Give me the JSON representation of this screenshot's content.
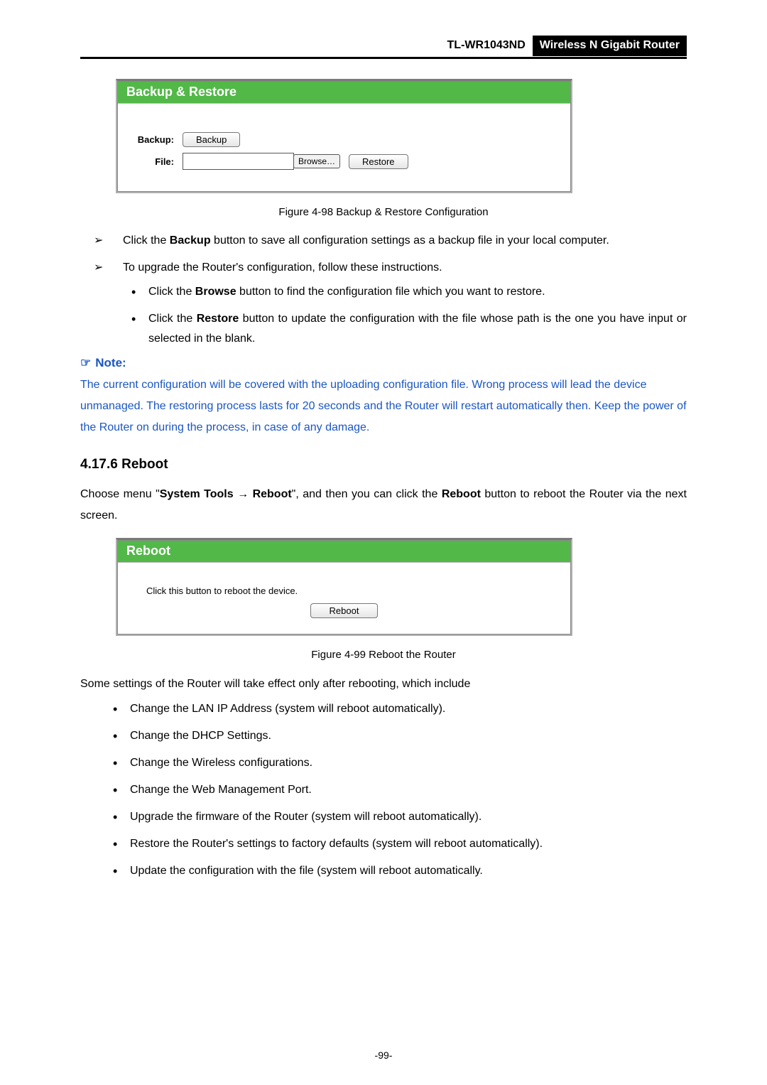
{
  "header": {
    "model": "TL-WR1043ND",
    "product": "Wireless N Gigabit Router"
  },
  "fig1": {
    "panel_title": "Backup & Restore",
    "backup_label": "Backup:",
    "backup_btn": "Backup",
    "file_label": "File:",
    "browse_btn": "Browse…",
    "restore_btn": "Restore",
    "caption": "Figure 4-98    Backup & Restore Configuration"
  },
  "bullets1": {
    "a_prefix": "Click the ",
    "a_bold": "Backup",
    "a_suffix": " button to save all configuration settings as a backup file in your local computer.",
    "b": "To upgrade the Router's configuration, follow these instructions.",
    "b1_prefix": "Click the ",
    "b1_bold": "Browse",
    "b1_suffix": " button to find the configuration file which you want to restore.",
    "b2_prefix": "Click the ",
    "b2_bold": "Restore",
    "b2_suffix": " button to update the configuration with the file whose path is the one you have input or selected in the blank."
  },
  "note": {
    "heading": "Note:",
    "body": "The current configuration will be covered with the uploading configuration file. Wrong process will lead the device unmanaged. The restoring process lasts for 20 seconds and the Router will restart automatically then. Keep the power of the Router on during the process, in case of any damage."
  },
  "section": {
    "number": "4.17.6  Reboot",
    "p1_a": "Choose menu \"",
    "p1_b": "System Tools",
    "p1_arrow": " → ",
    "p1_c": "Reboot",
    "p1_d": "\", and then you can click the ",
    "p1_e": "Reboot",
    "p1_f": " button to reboot the Router via the next screen."
  },
  "fig2": {
    "panel_title": "Reboot",
    "line": "Click this button to reboot the device.",
    "btn": "Reboot",
    "caption": "Figure 4-99 Reboot the Router"
  },
  "after": {
    "intro": "Some settings of the Router will take effect only after rebooting, which include",
    "items": [
      "Change the LAN IP Address (system will reboot automatically).",
      "Change the DHCP Settings.",
      "Change the Wireless configurations.",
      "Change the Web Management Port.",
      "Upgrade the firmware of the Router (system will reboot automatically).",
      "Restore the Router's settings to factory defaults (system will reboot automatically).",
      "Update the configuration with the file (system will reboot automatically."
    ]
  },
  "page_number": "-99-"
}
